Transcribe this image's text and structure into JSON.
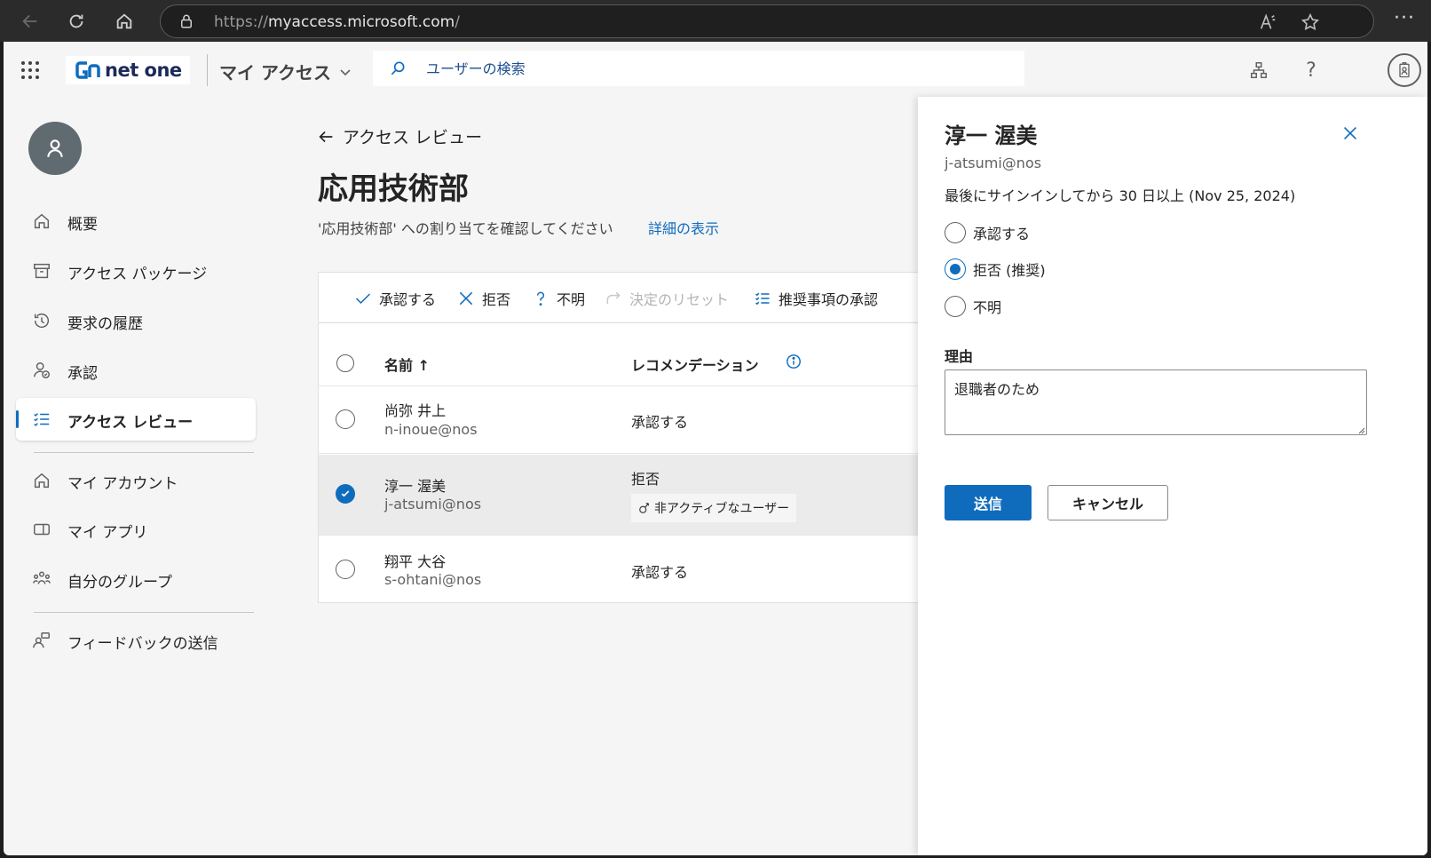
{
  "browser": {
    "url_prefix": "https://",
    "url_host": "myaccess.microsoft.com",
    "url_suffix": "/"
  },
  "header": {
    "logo_text": "net one",
    "app_title": "マイ アクセス",
    "search_placeholder": "ユーザーの検索"
  },
  "sidebar": {
    "items": [
      {
        "label": "概要",
        "icon": "home-icon"
      },
      {
        "label": "アクセス パッケージ",
        "icon": "package-icon"
      },
      {
        "label": "要求の履歴",
        "icon": "history-icon"
      },
      {
        "label": "承認",
        "icon": "approval-icon"
      },
      {
        "label": "アクセス レビュー",
        "icon": "review-list-icon",
        "active": true
      },
      {
        "label": "マイ アカウント",
        "icon": "home-icon"
      },
      {
        "label": "マイ アプリ",
        "icon": "apps-icon"
      },
      {
        "label": "自分のグループ",
        "icon": "groups-icon"
      },
      {
        "label": "フィードバックの送信",
        "icon": "feedback-icon"
      }
    ]
  },
  "main": {
    "back_label": "アクセス レビュー",
    "title": "応用技術部",
    "subtitle": "'応用技術部' への割り当てを確認してください",
    "details_link": "詳細の表示",
    "toolbar": {
      "approve": "承認する",
      "deny": "拒否",
      "unknown": "不明",
      "reset": "決定のリセット",
      "accept_recommendations": "推奨事項の承認"
    },
    "table": {
      "col_name": "名前 ↑",
      "col_recommendation": "レコメンデーション",
      "rows": [
        {
          "name": "尚弥 井上",
          "email": "n-inoue@nos",
          "recommendation": "承認する",
          "selected": false
        },
        {
          "name": "淳一 渥美",
          "email": "j-atsumi@nos",
          "recommendation": "拒否",
          "chip": "非アクティブなユーザー",
          "selected": true
        },
        {
          "name": "翔平 大谷",
          "email": "s-ohtani@nos",
          "recommendation": "承認する",
          "selected": false
        }
      ]
    }
  },
  "panel": {
    "name": "淳一 渥美",
    "email": "j-atsumi@nos",
    "signin_info": "最後にサインインしてから 30 日以上 (Nov 25, 2024)",
    "options": [
      "承認する",
      "拒否 (推奨)",
      "不明"
    ],
    "selected_option": "拒否 (推奨)",
    "reason_label": "理由",
    "reason_value": "退職者のため",
    "submit_label": "送信",
    "cancel_label": "キャンセル"
  },
  "colors": {
    "accent": "#0f6cbd",
    "background": "#f5f5f5"
  }
}
